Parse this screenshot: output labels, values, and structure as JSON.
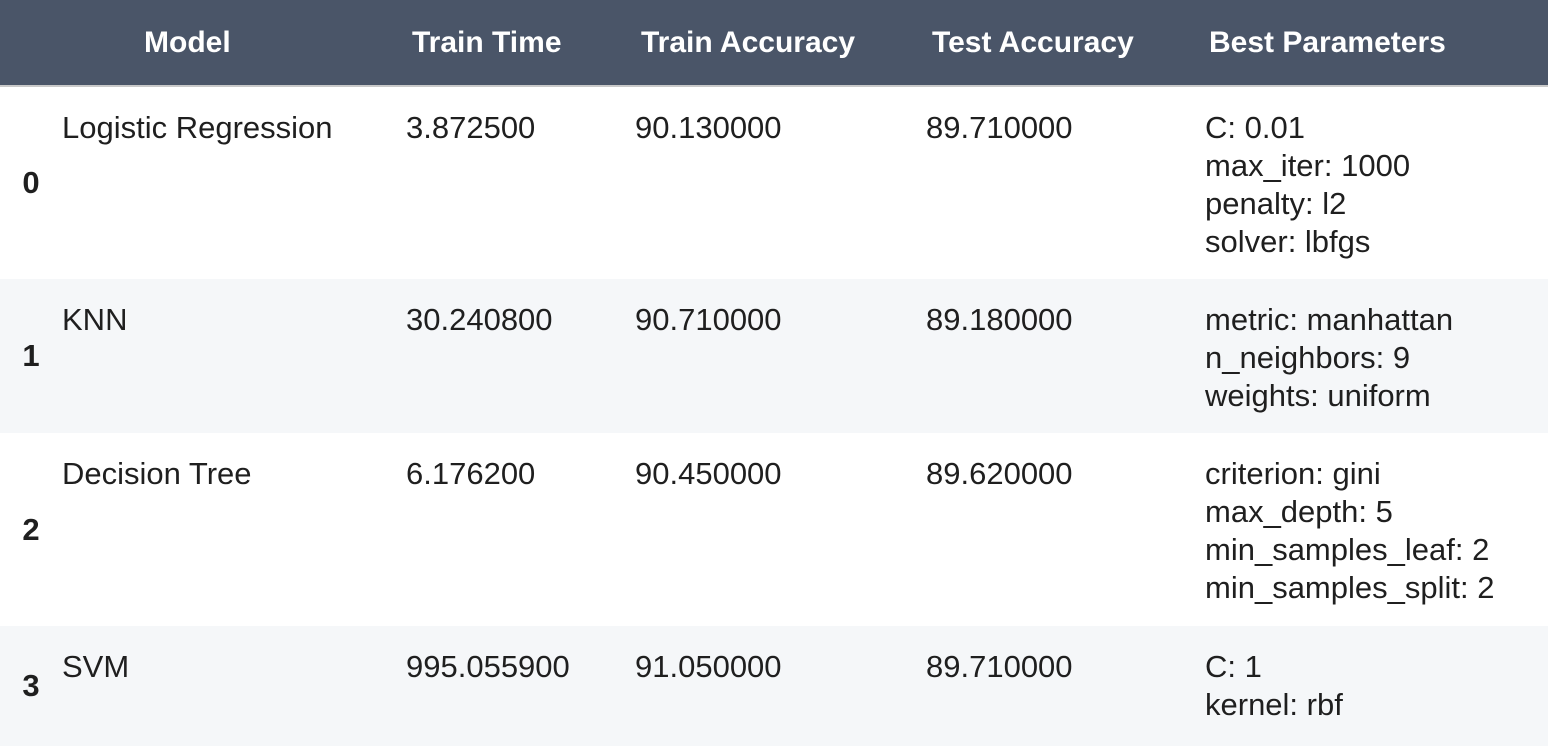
{
  "table": {
    "headers": {
      "index": "",
      "model": "Model",
      "train_time": "Train Time",
      "train_accuracy": "Train Accuracy",
      "test_accuracy": "Test Accuracy",
      "best_parameters": "Best Parameters"
    },
    "rows": [
      {
        "index": "0",
        "model": "Logistic Regression",
        "train_time": "3.872500",
        "train_accuracy": "90.130000",
        "test_accuracy": "89.710000",
        "best_parameters": [
          "C: 0.01",
          "max_iter: 1000",
          "penalty: l2",
          "solver: lbfgs"
        ]
      },
      {
        "index": "1",
        "model": "KNN",
        "train_time": "30.240800",
        "train_accuracy": "90.710000",
        "test_accuracy": "89.180000",
        "best_parameters": [
          "metric: manhattan",
          "n_neighbors: 9",
          "weights: uniform"
        ]
      },
      {
        "index": "2",
        "model": "Decision Tree",
        "train_time": "6.176200",
        "train_accuracy": "90.450000",
        "test_accuracy": "89.620000",
        "best_parameters": [
          "criterion: gini",
          "max_depth: 5",
          "min_samples_leaf: 2",
          "min_samples_split: 2"
        ]
      },
      {
        "index": "3",
        "model": "SVM",
        "train_time": "995.055900",
        "train_accuracy": "91.050000",
        "test_accuracy": "89.710000",
        "best_parameters": [
          "C: 1",
          "kernel: rbf"
        ]
      }
    ]
  },
  "colors": {
    "header_bg": "#4a5568",
    "header_text": "#ffffff",
    "row_stripe": "#f5f7f9",
    "row_plain": "#ffffff"
  }
}
